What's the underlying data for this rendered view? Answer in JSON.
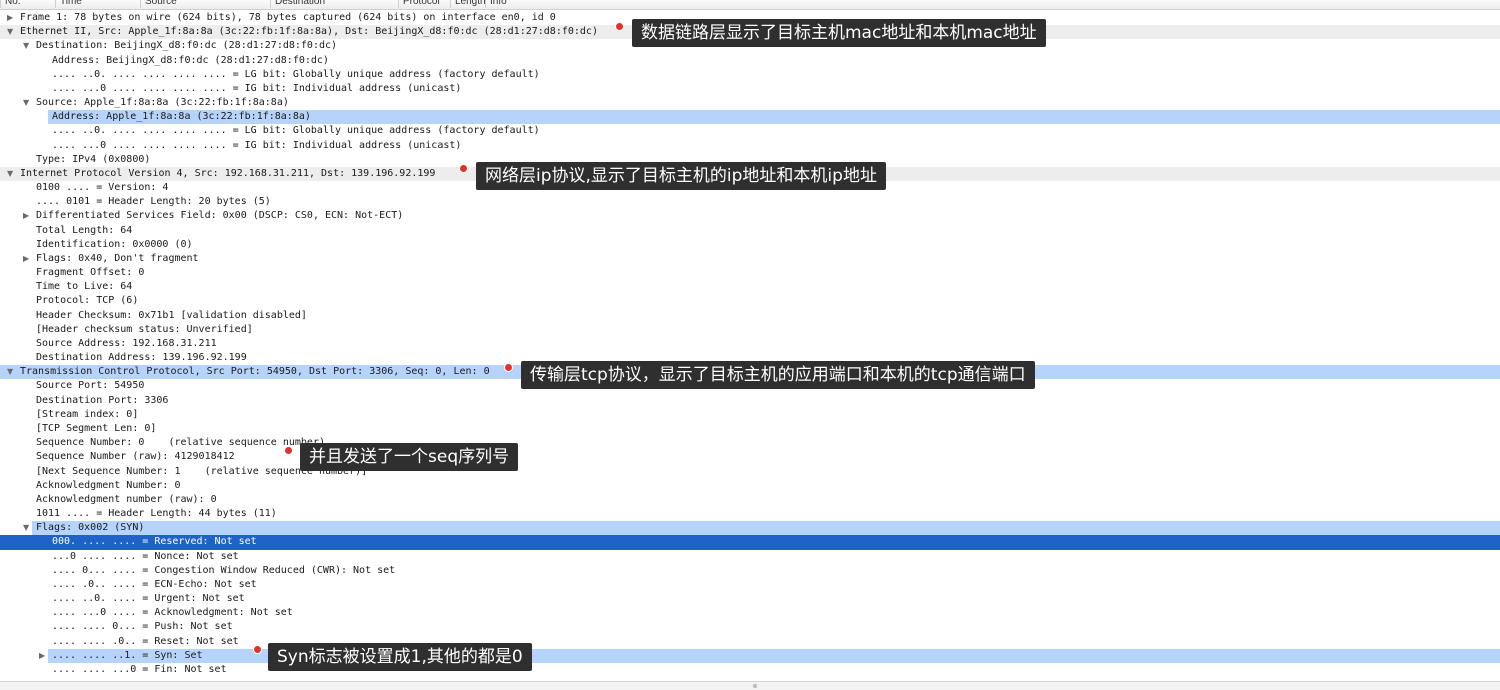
{
  "columns": [
    "No.",
    "Time",
    "Source",
    "Destination",
    "Protocol",
    "Length",
    "Info"
  ],
  "annotations": [
    "数据链路层显示了目标主机mac地址和本机mac地址",
    "网络层ip协议,显示了目标主机的ip地址和本机ip地址",
    "传输层tcp协议，显示了目标主机的应用端口和本机的tcp通信端口",
    "并且发送了一个seq序列号",
    "Syn标志被设置成1,其他的都是0"
  ],
  "rows": [
    {
      "text": "Frame 1: 78 bytes on wire (624 bits), 78 bytes captured (624 bits) on interface en0, id 0",
      "indent": 0,
      "expander": "collapsed",
      "style": ""
    },
    {
      "text": "Ethernet II, Src: Apple_1f:8a:8a (3c:22:fb:1f:8a:8a), Dst: BeijingX_d8:f0:dc (28:d1:27:d8:f0:dc)",
      "indent": 0,
      "expander": "expanded",
      "style": "section"
    },
    {
      "text": "Destination: BeijingX_d8:f0:dc (28:d1:27:d8:f0:dc)",
      "indent": 1,
      "expander": "expanded",
      "style": ""
    },
    {
      "text": "Address: BeijingX_d8:f0:dc (28:d1:27:d8:f0:dc)",
      "indent": 2,
      "expander": "",
      "style": ""
    },
    {
      "text": ".... ..0. .... .... .... .... = LG bit: Globally unique address (factory default)",
      "indent": 2,
      "expander": "",
      "style": ""
    },
    {
      "text": ".... ...0 .... .... .... .... = IG bit: Individual address (unicast)",
      "indent": 2,
      "expander": "",
      "style": ""
    },
    {
      "text": "Source: Apple_1f:8a:8a (3c:22:fb:1f:8a:8a)",
      "indent": 1,
      "expander": "expanded",
      "style": ""
    },
    {
      "text": "Address: Apple_1f:8a:8a (3c:22:fb:1f:8a:8a)",
      "indent": 2,
      "expander": "",
      "style": "light partial"
    },
    {
      "text": ".... ..0. .... .... .... .... = LG bit: Globally unique address (factory default)",
      "indent": 2,
      "expander": "",
      "style": ""
    },
    {
      "text": ".... ...0 .... .... .... .... = IG bit: Individual address (unicast)",
      "indent": 2,
      "expander": "",
      "style": ""
    },
    {
      "text": "Type: IPv4 (0x0800)",
      "indent": 1,
      "expander": "",
      "style": ""
    },
    {
      "text": "Internet Protocol Version 4, Src: 192.168.31.211, Dst: 139.196.92.199",
      "indent": 0,
      "expander": "expanded",
      "style": "section"
    },
    {
      "text": "0100 .... = Version: 4",
      "indent": 1,
      "expander": "",
      "style": ""
    },
    {
      "text": ".... 0101 = Header Length: 20 bytes (5)",
      "indent": 1,
      "expander": "",
      "style": ""
    },
    {
      "text": "Differentiated Services Field: 0x00 (DSCP: CS0, ECN: Not-ECT)",
      "indent": 1,
      "expander": "collapsed",
      "style": ""
    },
    {
      "text": "Total Length: 64",
      "indent": 1,
      "expander": "",
      "style": ""
    },
    {
      "text": "Identification: 0x0000 (0)",
      "indent": 1,
      "expander": "",
      "style": ""
    },
    {
      "text": "Flags: 0x40, Don't fragment",
      "indent": 1,
      "expander": "collapsed",
      "style": ""
    },
    {
      "text": "Fragment Offset: 0",
      "indent": 1,
      "expander": "",
      "style": ""
    },
    {
      "text": "Time to Live: 64",
      "indent": 1,
      "expander": "",
      "style": ""
    },
    {
      "text": "Protocol: TCP (6)",
      "indent": 1,
      "expander": "",
      "style": ""
    },
    {
      "text": "Header Checksum: 0x71b1 [validation disabled]",
      "indent": 1,
      "expander": "",
      "style": ""
    },
    {
      "text": "[Header checksum status: Unverified]",
      "indent": 1,
      "expander": "",
      "style": ""
    },
    {
      "text": "Source Address: 192.168.31.211",
      "indent": 1,
      "expander": "",
      "style": ""
    },
    {
      "text": "Destination Address: 139.196.92.199",
      "indent": 1,
      "expander": "",
      "style": ""
    },
    {
      "text": "Transmission Control Protocol, Src Port: 54950, Dst Port: 3306, Seq: 0, Len: 0",
      "indent": 0,
      "expander": "expanded",
      "style": "light"
    },
    {
      "text": "Source Port: 54950",
      "indent": 1,
      "expander": "",
      "style": ""
    },
    {
      "text": "Destination Port: 3306",
      "indent": 1,
      "expander": "",
      "style": ""
    },
    {
      "text": "[Stream index: 0]",
      "indent": 1,
      "expander": "",
      "style": ""
    },
    {
      "text": "[TCP Segment Len: 0]",
      "indent": 1,
      "expander": "",
      "style": ""
    },
    {
      "text": "Sequence Number: 0    (relative sequence number)",
      "indent": 1,
      "expander": "",
      "style": ""
    },
    {
      "text": "Sequence Number (raw): 4129018412",
      "indent": 1,
      "expander": "",
      "style": ""
    },
    {
      "text": "[Next Sequence Number: 1    (relative sequence number)]",
      "indent": 1,
      "expander": "",
      "style": ""
    },
    {
      "text": "Acknowledgment Number: 0",
      "indent": 1,
      "expander": "",
      "style": ""
    },
    {
      "text": "Acknowledgment number (raw): 0",
      "indent": 1,
      "expander": "",
      "style": ""
    },
    {
      "text": "1011 .... = Header Length: 44 bytes (11)",
      "indent": 1,
      "expander": "",
      "style": ""
    },
    {
      "text": "Flags: 0x002 (SYN)",
      "indent": 1,
      "expander": "expanded",
      "style": "light flags"
    },
    {
      "text": "000. .... .... = Reserved: Not set",
      "indent": 2,
      "expander": "",
      "style": "dark"
    },
    {
      "text": "...0 .... .... = Nonce: Not set",
      "indent": 2,
      "expander": "",
      "style": ""
    },
    {
      "text": ".... 0... .... = Congestion Window Reduced (CWR): Not set",
      "indent": 2,
      "expander": "",
      "style": ""
    },
    {
      "text": ".... .0.. .... = ECN-Echo: Not set",
      "indent": 2,
      "expander": "",
      "style": ""
    },
    {
      "text": ".... ..0. .... = Urgent: Not set",
      "indent": 2,
      "expander": "",
      "style": ""
    },
    {
      "text": ".... ...0 .... = Acknowledgment: Not set",
      "indent": 2,
      "expander": "",
      "style": ""
    },
    {
      "text": ".... .... 0... = Push: Not set",
      "indent": 2,
      "expander": "",
      "style": ""
    },
    {
      "text": ".... .... .0.. = Reset: Not set",
      "indent": 2,
      "expander": "",
      "style": ""
    },
    {
      "text": ".... .... ..1. = Syn: Set",
      "indent": 2,
      "expander": "collapsed",
      "style": "light partial"
    },
    {
      "text": ".... .... ...0 = Fin: Not set",
      "indent": 2,
      "expander": "",
      "style": ""
    }
  ]
}
